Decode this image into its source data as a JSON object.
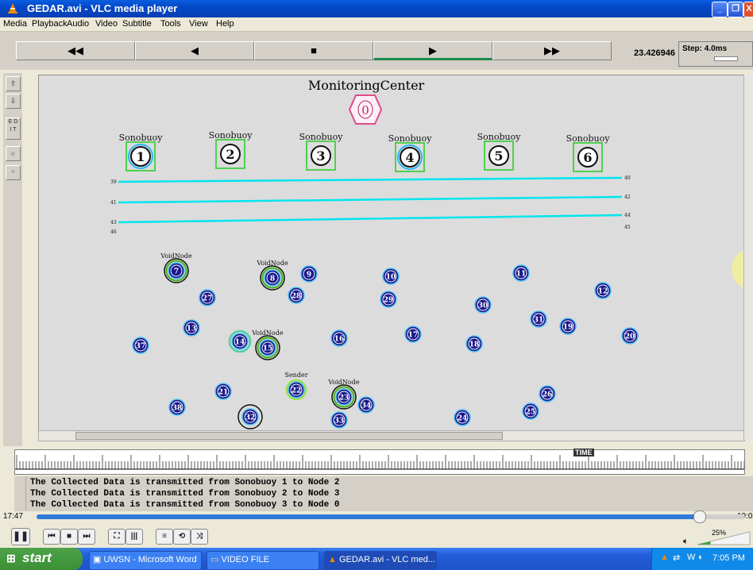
{
  "window": {
    "title": "GEDAR.avi - VLC media player",
    "min": "_",
    "max": "❐",
    "close": "X"
  },
  "menu": [
    "Media",
    "Playback",
    "Audio",
    "Video",
    "Subtitle",
    "Tools",
    "View",
    "Help"
  ],
  "nam": {
    "buttons": [
      "◀◀",
      "◀",
      "■",
      "▶",
      "▶▶"
    ],
    "time": "23.426946",
    "step": "Step: 4.0ms"
  },
  "tools": [
    "⇧",
    "⇩",
    "E D\nI T",
    "○",
    "○"
  ],
  "scene": {
    "center_label": "MonitoringCenter",
    "center_node": "0",
    "sonobuoys": [
      {
        "label": "Sonobuoy",
        "id": "1"
      },
      {
        "label": "Sonobuoy",
        "id": "2"
      },
      {
        "label": "Sonobuoy",
        "id": "3"
      },
      {
        "label": "Sonobuoy",
        "id": "4"
      },
      {
        "label": "Sonobuoy",
        "id": "5"
      },
      {
        "label": "Sonobuoy",
        "id": "6"
      }
    ],
    "lines": [
      {
        "left": "39",
        "right": "40"
      },
      {
        "left": "41",
        "right": "42"
      },
      {
        "left": "43",
        "right": "44"
      },
      {
        "left": "46",
        "right": "45"
      }
    ],
    "nodes": [
      {
        "id": "7",
        "label": "VoidNode"
      },
      {
        "id": "8",
        "label": "VoidNode"
      },
      {
        "id": "9",
        "label": ""
      },
      {
        "id": "10",
        "label": ""
      },
      {
        "id": "11",
        "label": ""
      },
      {
        "id": "12",
        "label": ""
      },
      {
        "id": "13",
        "label": ""
      },
      {
        "id": "14",
        "label": ""
      },
      {
        "id": "15",
        "label": "VoidNode"
      },
      {
        "id": "16",
        "label": ""
      },
      {
        "id": "17",
        "label": ""
      },
      {
        "id": "18",
        "label": ""
      },
      {
        "id": "19",
        "label": ""
      },
      {
        "id": "20",
        "label": ""
      },
      {
        "id": "21",
        "label": ""
      },
      {
        "id": "22",
        "label": "Sender"
      },
      {
        "id": "23",
        "label": "VoidNode"
      },
      {
        "id": "24",
        "label": ""
      },
      {
        "id": "25",
        "label": ""
      },
      {
        "id": "26",
        "label": ""
      },
      {
        "id": "27",
        "label": ""
      },
      {
        "id": "28",
        "label": ""
      },
      {
        "id": "29",
        "label": ""
      },
      {
        "id": "30",
        "label": ""
      },
      {
        "id": "31",
        "label": ""
      },
      {
        "id": "32",
        "label": ""
      },
      {
        "id": "33",
        "label": ""
      },
      {
        "id": "34",
        "label": ""
      },
      {
        "id": "37",
        "label": ""
      },
      {
        "id": "38",
        "label": ""
      }
    ]
  },
  "ruler_label": "TIME",
  "log": [
    "The Collected Data is transmitted from Sonobuoy 1 to Node 2",
    "The Collected Data is transmitted from Sonobuoy 2 to Node 3",
    "The Collected Data is transmitted from Sonobuoy 3 to Node 0"
  ],
  "seek": {
    "elapsed": "17:47",
    "total": "19:0",
    "progress": 0.936
  },
  "volume": {
    "level": "25%"
  },
  "taskbar": {
    "start": "start",
    "tasks": [
      "UWSN - Microsoft Word",
      "VIDEO FILE",
      "GEDAR.avi - VLC med..."
    ],
    "clock": "7:05 PM"
  },
  "colors": {
    "sonobuoy_box": "#22cc22",
    "link": "#00e5ee",
    "node_fill": "#1a1a8c",
    "void_ring": "#4caf1a",
    "center": "#e04a8c"
  }
}
